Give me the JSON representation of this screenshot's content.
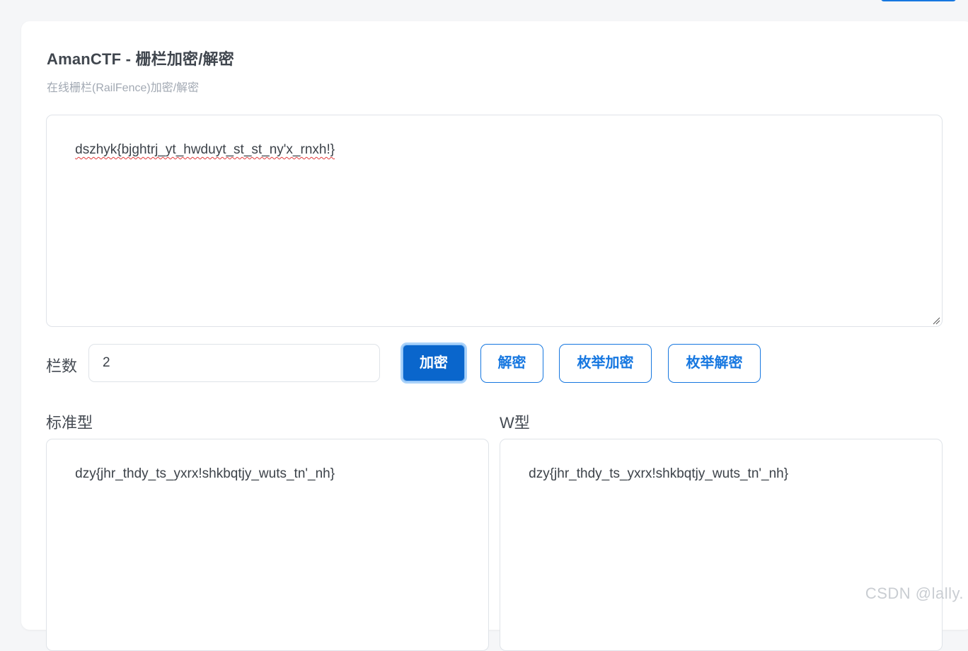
{
  "header": {
    "title": "AmanCTF - 栅栏加密/解密",
    "subtitle": "在线栅栏(RailFence)加密/解密"
  },
  "input": {
    "value": "dszhyk{bjghtrj_yt_hwduyt_st_st_ny'x_rnxh!}"
  },
  "controls": {
    "rails_label": "栏数",
    "rails_value": "2",
    "encrypt_label": "加密",
    "decrypt_label": "解密",
    "enum_encrypt_label": "枚举加密",
    "enum_decrypt_label": "枚举解密"
  },
  "outputs": {
    "standard_label": "标准型",
    "standard_value": "dzy{jhr_thdy_ts_yxrx!shkbqtjy_wuts_tn'_nh}",
    "w_label": "W型",
    "w_value": "dzy{jhr_thdy_ts_yxrx!shkbqtjy_wuts_tn'_nh}"
  },
  "watermark": "CSDN @lally.",
  "colors": {
    "accent": "#1677e0",
    "primary_button": "#0a66cc",
    "background": "#f5f6f8"
  }
}
